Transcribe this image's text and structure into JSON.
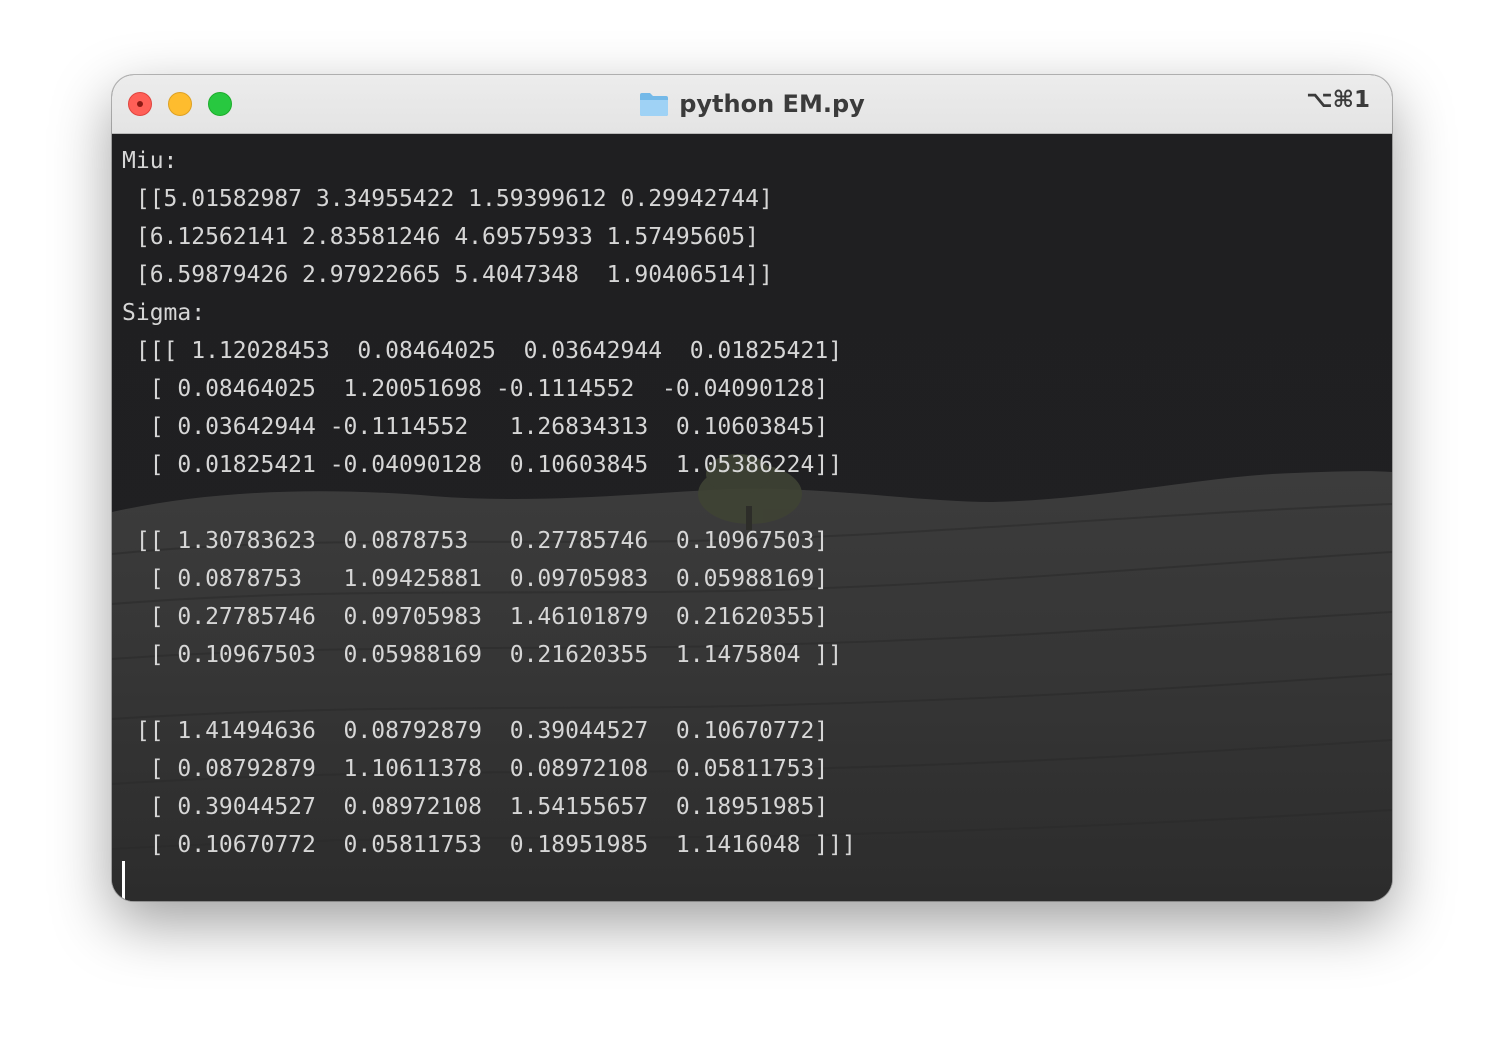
{
  "window": {
    "title": "python EM.py",
    "shortcut": "⌥⌘1",
    "title_icon": "folder-icon"
  },
  "colors": {
    "close": "#ff5f57",
    "minimize": "#febc2e",
    "zoom": "#28c840",
    "terminal_text": "#d6d6d6",
    "terminal_background": "#1c1c1e"
  },
  "terminal": {
    "lines": [
      "Miu:",
      " [[5.01582987 3.34955422 1.59399612 0.29942744]",
      " [6.12562141 2.83581246 4.69575933 1.57495605]",
      " [6.59879426 2.97922665 5.4047348  1.90406514]]",
      "Sigma:",
      " [[[ 1.12028453  0.08464025  0.03642944  0.01825421]",
      "  [ 0.08464025  1.20051698 -0.1114552  -0.04090128]",
      "  [ 0.03642944 -0.1114552   1.26834313  0.10603845]",
      "  [ 0.01825421 -0.04090128  0.10603845  1.05386224]]",
      "",
      " [[ 1.30783623  0.0878753   0.27785746  0.10967503]",
      "  [ 0.0878753   1.09425881  0.09705983  0.05988169]",
      "  [ 0.27785746  0.09705983  1.46101879  0.21620355]",
      "  [ 0.10967503  0.05988169  0.21620355  1.1475804 ]]",
      "",
      " [[ 1.41494636  0.08792879  0.39044527  0.10670772]",
      "  [ 0.08792879  1.10611378  0.08972108  0.05811753]",
      "  [ 0.39044527  0.08972108  1.54155657  0.18951985]",
      "  [ 0.10670772  0.05811753  0.18951985  1.1416048 ]]]"
    ]
  }
}
